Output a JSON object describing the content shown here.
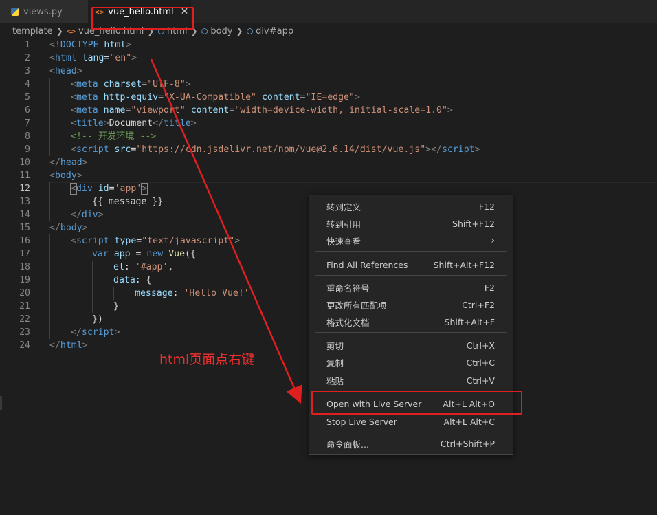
{
  "tabs": [
    {
      "label": "views.py",
      "icon": "python-file-icon"
    },
    {
      "label": "vue_hello.html",
      "icon": "html-file-icon",
      "close": "✕"
    }
  ],
  "breadcrumb": [
    "template",
    "vue_hello.html",
    "html",
    "body",
    "div#app"
  ],
  "editor": {
    "active_line": "12",
    "lines": [
      {
        "n": "1"
      },
      {
        "n": "2"
      },
      {
        "n": "3"
      },
      {
        "n": "4"
      },
      {
        "n": "5"
      },
      {
        "n": "6"
      },
      {
        "n": "7"
      },
      {
        "n": "8"
      },
      {
        "n": "9"
      },
      {
        "n": "10"
      },
      {
        "n": "11"
      },
      {
        "n": "12"
      },
      {
        "n": "13"
      },
      {
        "n": "14"
      },
      {
        "n": "15"
      },
      {
        "n": "16"
      },
      {
        "n": "17"
      },
      {
        "n": "18"
      },
      {
        "n": "19"
      },
      {
        "n": "20"
      },
      {
        "n": "21"
      },
      {
        "n": "22"
      },
      {
        "n": "23"
      },
      {
        "n": "24"
      }
    ],
    "code": {
      "l1": {
        "open": "<!",
        "tag": "DOCTYPE",
        "sp": " ",
        "attr": "html",
        "close": ">"
      },
      "l2": {
        "open": "<",
        "tag": "html",
        "attr": " lang",
        "eq": "=",
        "val": "\"en\"",
        "close": ">"
      },
      "l3": {
        "open": "<",
        "tag": "head",
        "close": ">"
      },
      "l4": {
        "open": "<",
        "tag": "meta",
        "attr": " charset",
        "eq": "=",
        "val": "\"UTF-8\"",
        "close": ">"
      },
      "l5": {
        "open": "<",
        "tag": "meta",
        "attr1": " http-equiv",
        "eq": "=",
        "val1": "\"X-UA-Compatible\"",
        "attr2": " content",
        "val2": "\"IE=edge\"",
        "close": ">"
      },
      "l6": {
        "open": "<",
        "tag": "meta",
        "attr1": " name",
        "eq": "=",
        "val1": "\"viewport\"",
        "attr2": " content",
        "val2": "\"width=device-width, initial-scale=1.0\"",
        "close": ">"
      },
      "l7": {
        "open": "<",
        "tag": "title",
        "close": ">",
        "text": "Document",
        "endopen": "</",
        "endtag": "title"
      },
      "l8": {
        "comment": "<!-- 开发环境 -->"
      },
      "l9": {
        "open": "<",
        "tag": "script",
        "attr": " src",
        "eq": "=",
        "q": "\"",
        "url": "https://cdn.jsdelivr.net/npm/vue@2.6.14/dist/vue.js",
        "close": ">",
        "endopen": "</",
        "endtag": "script"
      },
      "l10": {
        "open": "</",
        "tag": "head",
        "close": ">"
      },
      "l11": {
        "open": "<",
        "tag": "body",
        "close": ">"
      },
      "l12": {
        "open": "<",
        "tag": "div",
        "attr": " id",
        "eq": "=",
        "val": "'app'",
        "close": ">"
      },
      "l13": {
        "text": "{{ message }}"
      },
      "l14": {
        "open": "</",
        "tag": "div",
        "close": ">"
      },
      "l15": {
        "open": "</",
        "tag": "body",
        "close": ">"
      },
      "l16": {
        "open": "<",
        "tag": "script",
        "attr": " type",
        "eq": "=",
        "val": "\"text/javascript\"",
        "close": ">"
      },
      "l17": {
        "kw": "var",
        "name": " app",
        "eq": " = ",
        "kw2": "new",
        "fn": " Vue",
        "rest": "({"
      },
      "l18": {
        "key": "el",
        "colon": ": ",
        "val": "'#app'",
        "comma": ","
      },
      "l19": {
        "key": "data",
        "rest": ": {"
      },
      "l20": {
        "key": "message",
        "colon": ": ",
        "val": "'Hello Vue!'"
      },
      "l21": {
        "text": "}"
      },
      "l22": {
        "text": "})"
      },
      "l23": {
        "open": "</",
        "tag": "script",
        "close": ">"
      },
      "l24": {
        "open": "</",
        "tag": "html",
        "close": ">"
      }
    }
  },
  "annotation": "html页面点右键",
  "context_menu": [
    {
      "label": "转到定义",
      "key": "F12"
    },
    {
      "label": "转到引用",
      "key": "Shift+F12"
    },
    {
      "label": "快速查看",
      "key": "›"
    },
    {
      "label": "Find All References",
      "key": "Shift+Alt+F12"
    },
    {
      "label": "重命名符号",
      "key": "F2"
    },
    {
      "label": "更改所有匹配项",
      "key": "Ctrl+F2"
    },
    {
      "label": "格式化文档",
      "key": "Shift+Alt+F"
    },
    {
      "label": "剪切",
      "key": "Ctrl+X"
    },
    {
      "label": "复制",
      "key": "Ctrl+C"
    },
    {
      "label": "粘贴",
      "key": "Ctrl+V"
    },
    {
      "label": "Open with Live Server",
      "key": "Alt+L Alt+O"
    },
    {
      "label": "Stop Live Server",
      "key": "Alt+L Alt+C"
    },
    {
      "label": "命令面板...",
      "key": "Ctrl+Shift+P"
    }
  ],
  "colors": {
    "highlight": "#e02020",
    "editor_bg": "#1e1e1e",
    "menu_bg": "#252526"
  }
}
